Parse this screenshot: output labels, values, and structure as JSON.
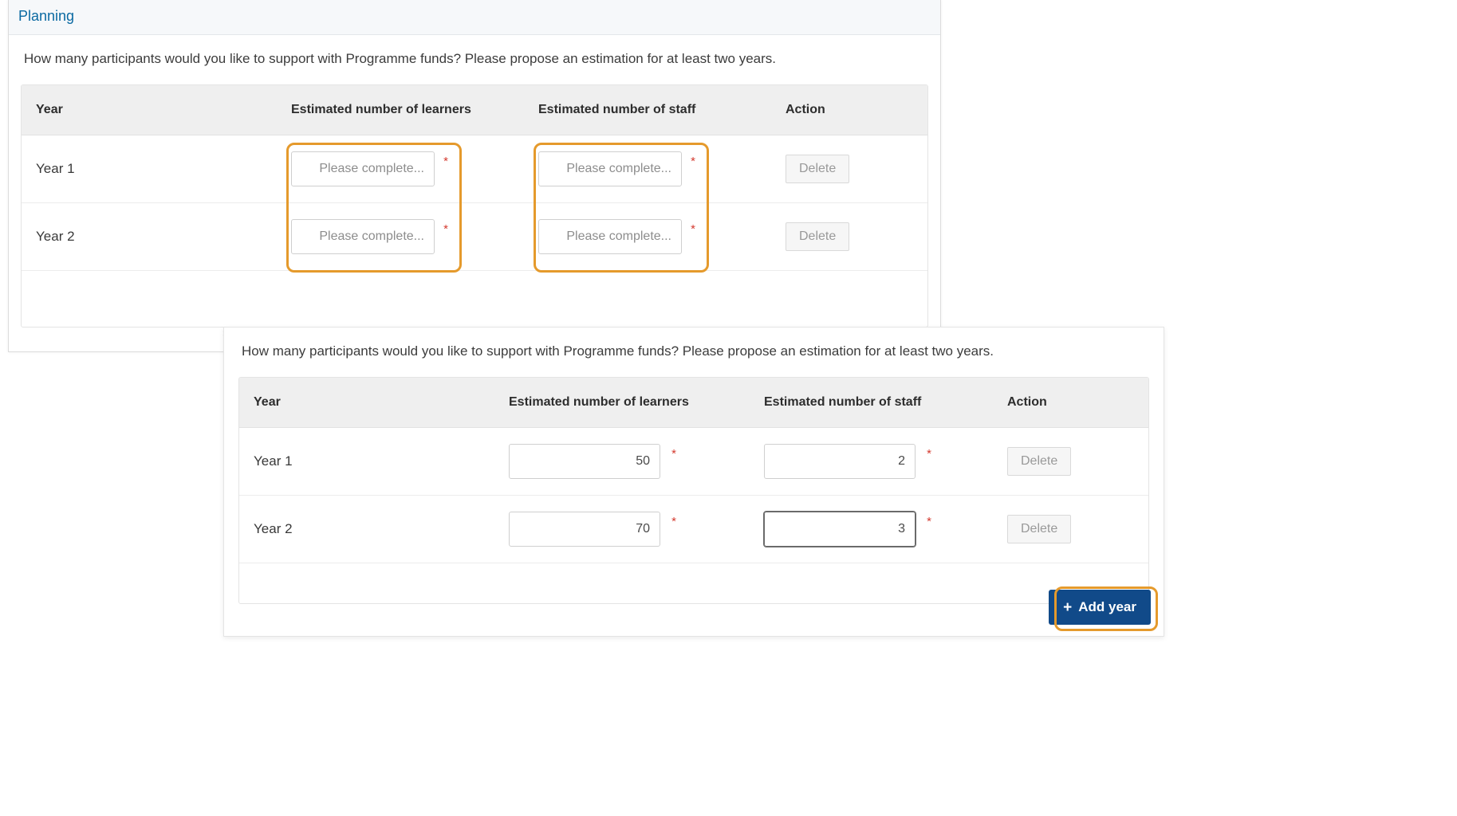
{
  "panel1": {
    "title": "Planning",
    "question": "How many participants would you like to support with Programme funds? Please propose an estimation for at least two years.",
    "columns": {
      "year": "Year",
      "learners": "Estimated number of learners",
      "staff": "Estimated number of staff",
      "action": "Action"
    },
    "rows": [
      {
        "year": "Year 1",
        "learners_value": "",
        "learners_placeholder": "Please complete...",
        "staff_value": "",
        "staff_placeholder": "Please complete...",
        "action": "Delete"
      },
      {
        "year": "Year 2",
        "learners_value": "",
        "learners_placeholder": "Please complete...",
        "staff_value": "",
        "staff_placeholder": "Please complete...",
        "action": "Delete"
      }
    ]
  },
  "panel2": {
    "question": "How many participants would you like to support with Programme funds? Please propose an estimation for at least two years.",
    "columns": {
      "year": "Year",
      "learners": "Estimated number of learners",
      "staff": "Estimated number of staff",
      "action": "Action"
    },
    "rows": [
      {
        "year": "Year 1",
        "learners_value": "50",
        "staff_value": "2",
        "action": "Delete"
      },
      {
        "year": "Year 2",
        "learners_value": "70",
        "staff_value": "3",
        "action": "Delete"
      }
    ],
    "add_year_label": "Add year"
  },
  "required_marker": "*",
  "highlights": {
    "panel1_learners_box": true,
    "panel1_staff_box": true,
    "panel2_addyear_box": true
  }
}
